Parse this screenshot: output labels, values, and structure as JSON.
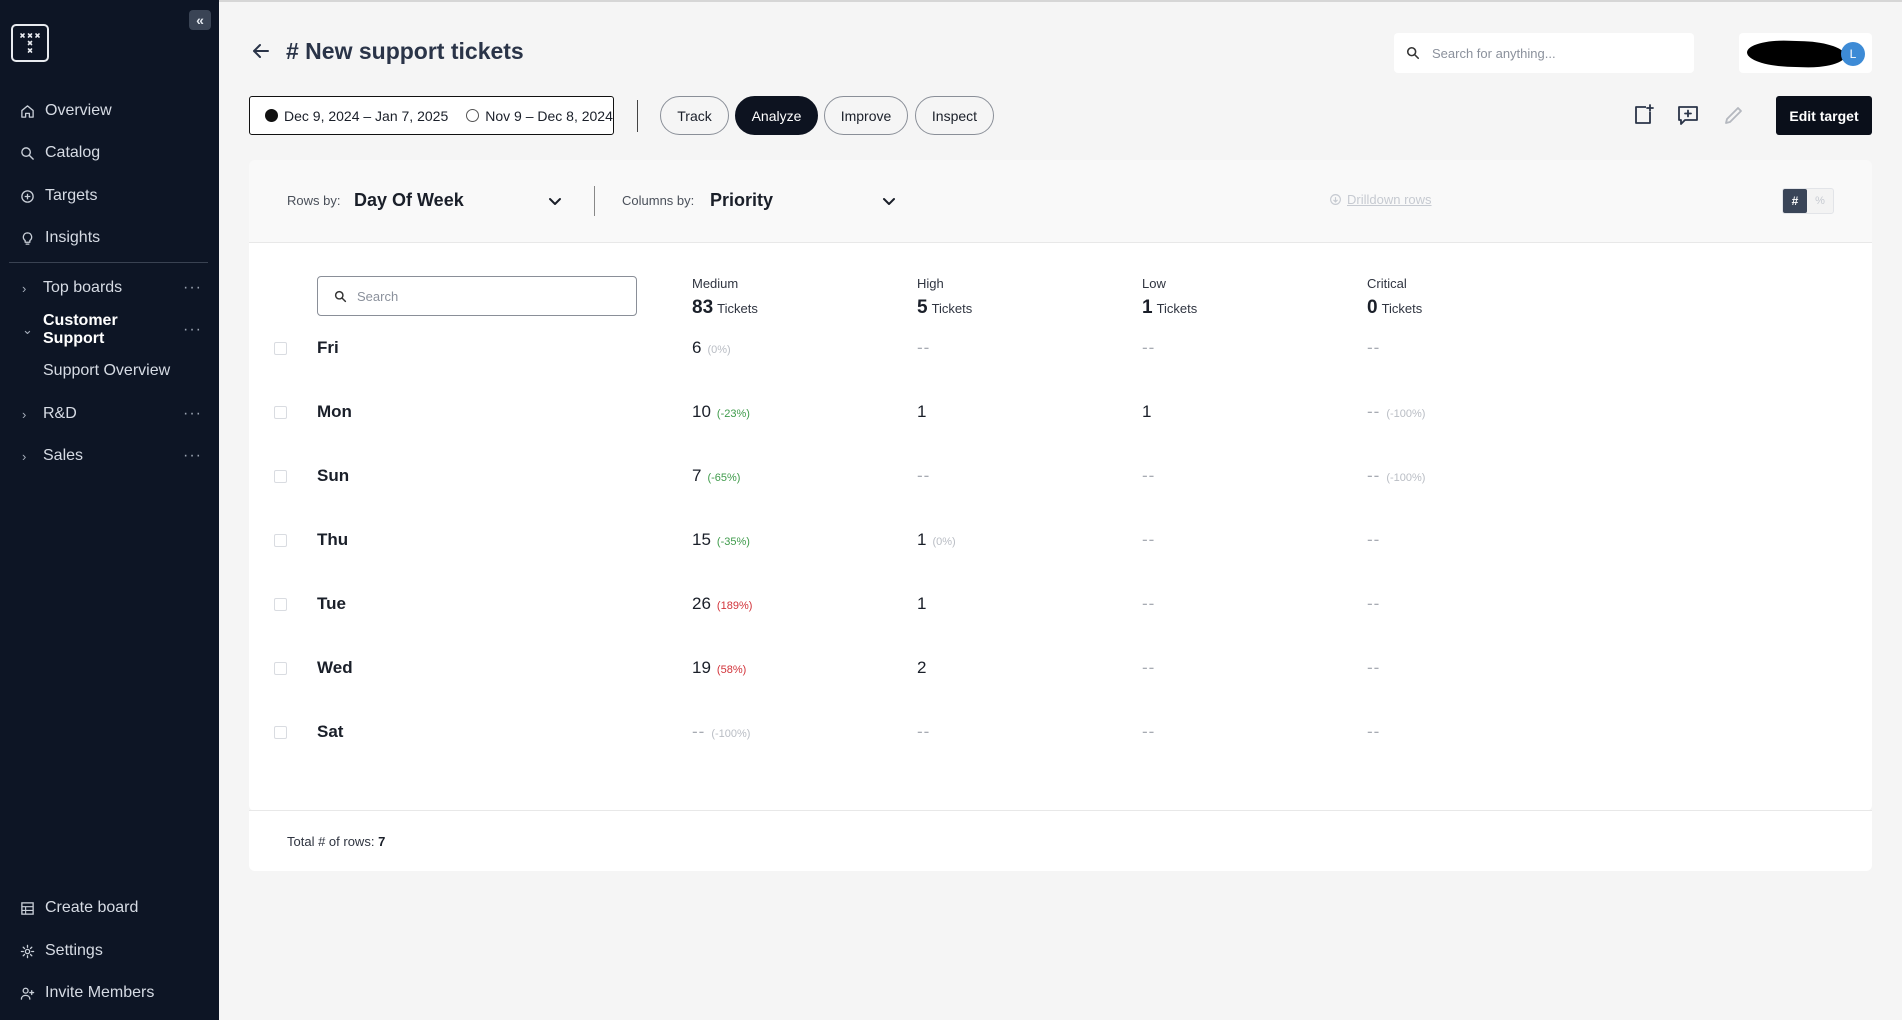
{
  "sidebar": {
    "nav": [
      {
        "label": "Overview",
        "icon": "home-icon"
      },
      {
        "label": "Catalog",
        "icon": "search-icon"
      },
      {
        "label": "Targets",
        "icon": "target-icon"
      },
      {
        "label": "Insights",
        "icon": "lightbulb-icon"
      }
    ],
    "boards": [
      {
        "label": "Top boards",
        "expanded": false
      },
      {
        "label": "Customer Support",
        "expanded": true
      },
      {
        "label": "R&D",
        "expanded": false
      },
      {
        "label": "Sales",
        "expanded": false
      }
    ],
    "sub_item": "Support Overview",
    "bottom": [
      {
        "label": "Create board",
        "icon": "grid-icon"
      },
      {
        "label": "Settings",
        "icon": "gear-icon"
      },
      {
        "label": "Invite Members",
        "icon": "user-plus-icon"
      }
    ]
  },
  "header": {
    "title": "# New support tickets",
    "search_placeholder": "Search for anything...",
    "avatar_initial": "L"
  },
  "toolbar": {
    "current_range": "Dec 9, 2024 – Jan 7, 2025",
    "compare_range": "Nov 9 – Dec 8, 2024",
    "tabs": [
      "Track",
      "Analyze",
      "Improve",
      "Inspect"
    ],
    "active_tab": "Analyze",
    "edit_target": "Edit target"
  },
  "pivot": {
    "rows_by_label": "Rows by:",
    "rows_by_value": "Day Of Week",
    "columns_by_label": "Columns by:",
    "columns_by_value": "Priority",
    "drilldown_label": "Drilldown rows",
    "toggle_num": "#",
    "toggle_pct": "%",
    "search_placeholder": "Search",
    "unit": "Tickets",
    "columns": [
      {
        "name": "Medium",
        "total": "83"
      },
      {
        "name": "High",
        "total": "5"
      },
      {
        "name": "Low",
        "total": "1"
      },
      {
        "name": "Critical",
        "total": "0"
      }
    ],
    "rows": [
      {
        "name": "Fri",
        "cells": [
          {
            "v": "6",
            "d": "(0%)",
            "t": "neutral"
          },
          {
            "v": "--"
          },
          {
            "v": "--"
          },
          {
            "v": "--"
          }
        ]
      },
      {
        "name": "Mon",
        "cells": [
          {
            "v": "10",
            "d": "(-23%)",
            "t": "good"
          },
          {
            "v": "1"
          },
          {
            "v": "1"
          },
          {
            "v": "--",
            "d": "(-100%)",
            "t": "neutral"
          }
        ]
      },
      {
        "name": "Sun",
        "cells": [
          {
            "v": "7",
            "d": "(-65%)",
            "t": "good"
          },
          {
            "v": "--"
          },
          {
            "v": "--"
          },
          {
            "v": "--",
            "d": "(-100%)",
            "t": "neutral"
          }
        ]
      },
      {
        "name": "Thu",
        "cells": [
          {
            "v": "15",
            "d": "(-35%)",
            "t": "good"
          },
          {
            "v": "1",
            "d": "(0%)",
            "t": "neutral"
          },
          {
            "v": "--"
          },
          {
            "v": "--"
          }
        ]
      },
      {
        "name": "Tue",
        "cells": [
          {
            "v": "26",
            "d": "(189%)",
            "t": "bad"
          },
          {
            "v": "1"
          },
          {
            "v": "--"
          },
          {
            "v": "--"
          }
        ]
      },
      {
        "name": "Wed",
        "cells": [
          {
            "v": "19",
            "d": "(58%)",
            "t": "bad"
          },
          {
            "v": "2"
          },
          {
            "v": "--"
          },
          {
            "v": "--"
          }
        ]
      },
      {
        "name": "Sat",
        "cells": [
          {
            "v": "--",
            "d": "(-100%)",
            "t": "neutral"
          },
          {
            "v": "--"
          },
          {
            "v": "--"
          },
          {
            "v": "--"
          }
        ]
      }
    ],
    "total_rows_label": "Total # of rows:",
    "total_rows_value": "7"
  }
}
